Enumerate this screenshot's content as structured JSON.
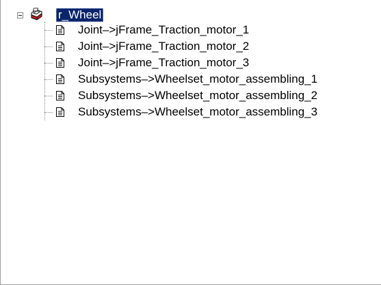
{
  "tree": {
    "root": {
      "label": "r_Wheel",
      "icon": "printer-assembly-icon",
      "expanded": true,
      "selected": true
    },
    "children": [
      {
        "label": "Joint–>jFrame_Traction_motor_1",
        "icon": "document-icon"
      },
      {
        "label": "Joint–>jFrame_Traction_motor_2",
        "icon": "document-icon"
      },
      {
        "label": "Joint–>jFrame_Traction_motor_3",
        "icon": "document-icon"
      },
      {
        "label": "Subsystems–>Wheelset_motor_assembling_1",
        "icon": "document-icon"
      },
      {
        "label": "Subsystems–>Wheelset_motor_assembling_2",
        "icon": "document-icon"
      },
      {
        "label": "Subsystems–>Wheelset_motor_assembling_3",
        "icon": "document-icon"
      }
    ]
  },
  "colors": {
    "selection_bg": "#0a246a",
    "selection_text": "#ffffff",
    "connector": "#8a8a8a",
    "root_icon_red": "#d42020"
  }
}
